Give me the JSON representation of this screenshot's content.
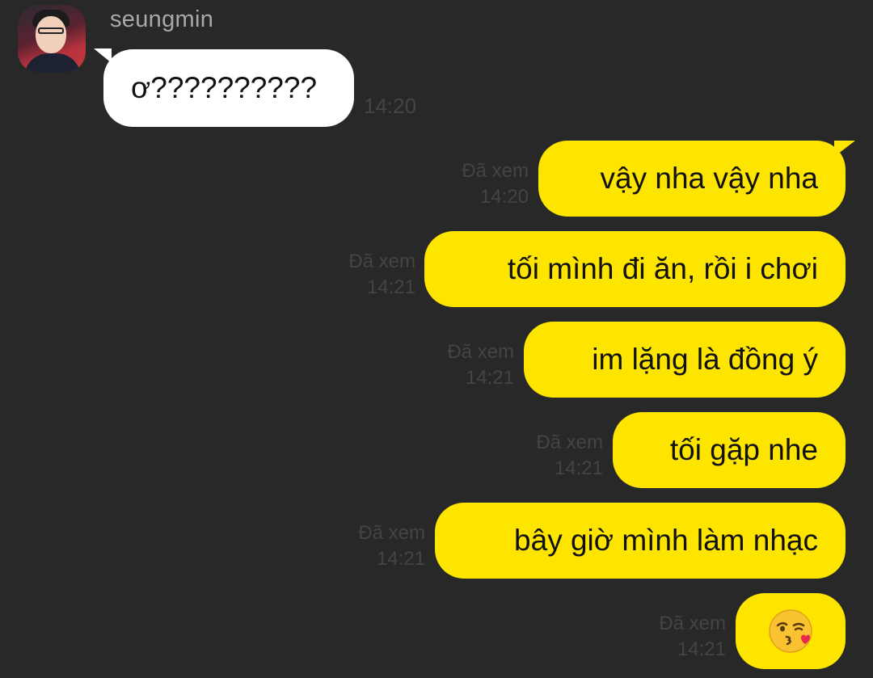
{
  "contact": {
    "name": "seungmin",
    "avatar": "profile-photo"
  },
  "messages": [
    {
      "direction": "incoming",
      "text": "ơ??????????",
      "time": "14:20"
    },
    {
      "direction": "outgoing",
      "text": "vậy nha vậy nha",
      "status": "Đã xem",
      "time": "14:20"
    },
    {
      "direction": "outgoing",
      "text": "tối mình đi ăn, rồi i chơi",
      "status": "Đã xem",
      "time": "14:21"
    },
    {
      "direction": "outgoing",
      "text": "im lặng là đồng ý",
      "status": "Đã xem",
      "time": "14:21"
    },
    {
      "direction": "outgoing",
      "text": "tối gặp nhe",
      "status": "Đã xem",
      "time": "14:21"
    },
    {
      "direction": "outgoing",
      "text": "bây giờ mình làm nhạc",
      "status": "Đã xem",
      "time": "14:21"
    },
    {
      "direction": "outgoing",
      "emoji": "kissing-face-with-heart",
      "status": "Đã xem",
      "time": "14:21"
    }
  ],
  "colors": {
    "background": "#282828",
    "outgoing_bubble": "#fee500",
    "incoming_bubble": "#ffffff",
    "meta_text": "#444444",
    "name_text": "#a9a9a9"
  }
}
